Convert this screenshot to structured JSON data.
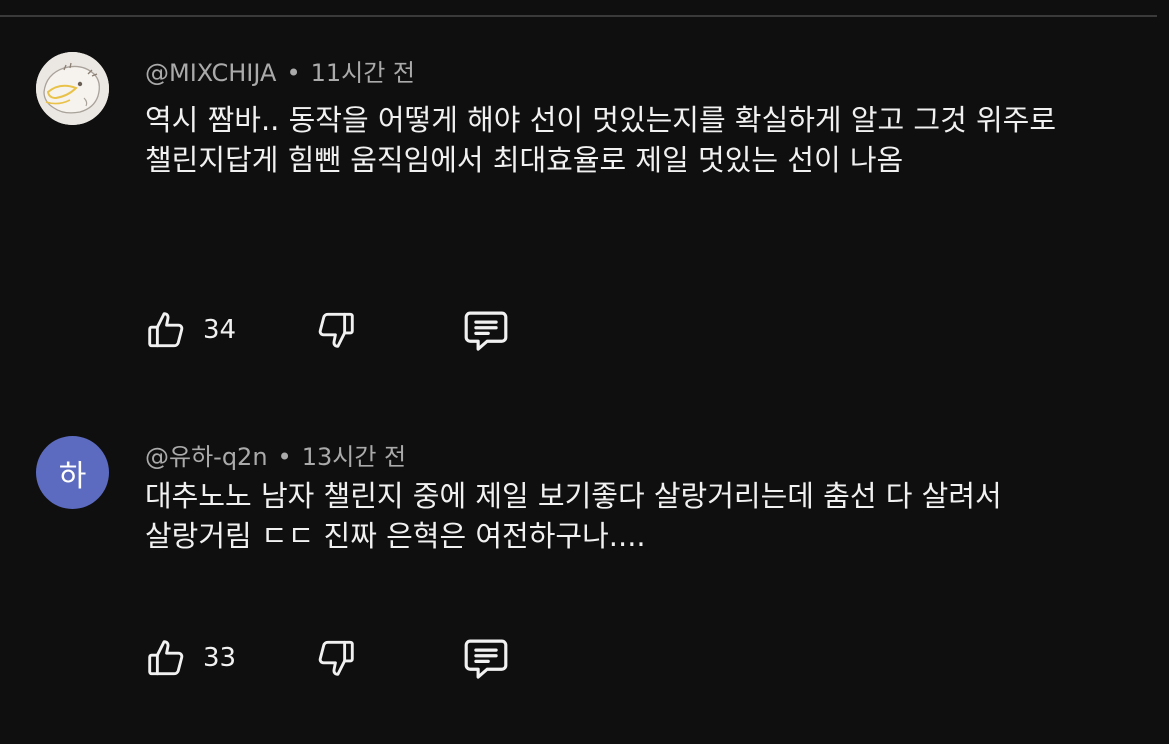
{
  "comments": [
    {
      "author": "@MIXCHIJA",
      "separator": "•",
      "time": "11시간 전",
      "text": "역시 짬바.. 동작을 어떻게 해야 선이 멋있는지를 확실하게 알고 그것 위주로 챌린지답게 힘뺀 움직임에서 최대효율로 제일 멋있는 선이 나옴",
      "likes": "34",
      "avatar_icon": "illustrated-avatar-icon"
    },
    {
      "author": "@유하-q2n",
      "separator": "•",
      "time": "13시간 전",
      "text": "대추노노 남자 챌린지 중에 제일 보기좋다 살랑거리는데 춤선 다 살려서 살랑거림 ㄷㄷ 진짜 은혁은 여전하구나....",
      "likes": "33",
      "avatar_letter": "하",
      "avatar_color": "#5c6bc0"
    }
  ],
  "icons": {
    "like": "thumbs-up-icon",
    "dislike": "thumbs-down-icon",
    "reply": "comment-reply-icon"
  }
}
